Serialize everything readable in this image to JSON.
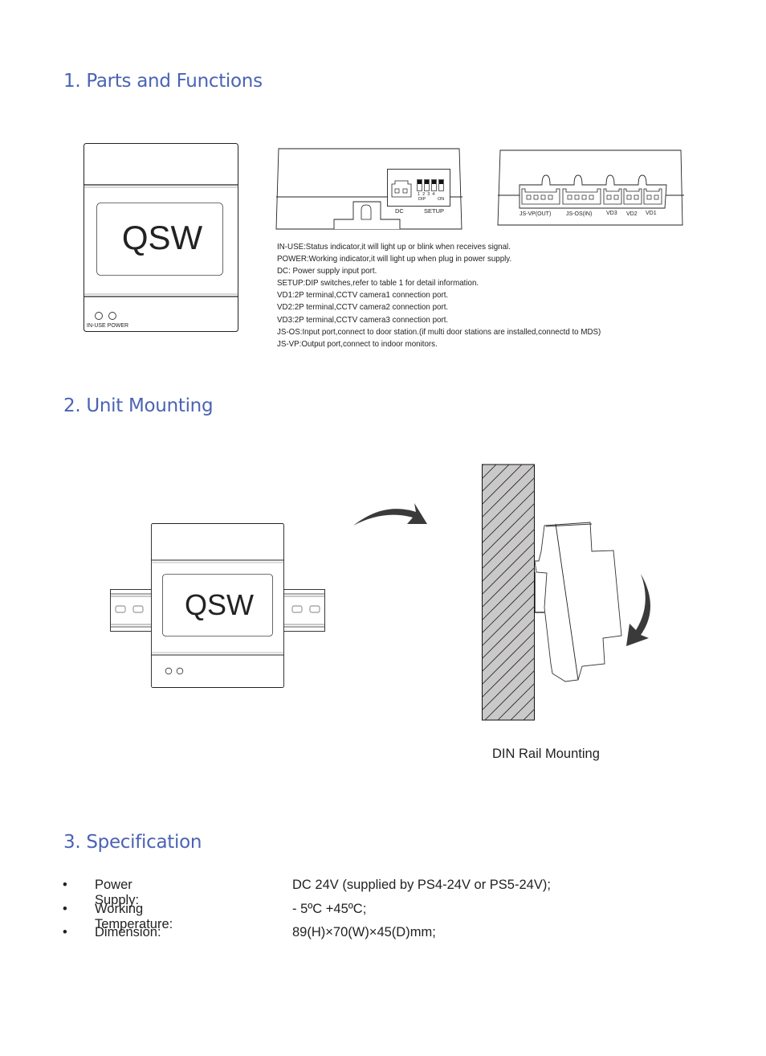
{
  "sections": {
    "parts": {
      "heading": "1. Parts and Functions",
      "front_view": {
        "device_label": "QSW",
        "indicator_labels": "IN-USE POWER"
      },
      "top_view": {
        "dc_label": "DC",
        "setup_label": "SETUP",
        "dip_numbers": "1  2  3  4",
        "dip_left": "DIP",
        "dip_right": "ON"
      },
      "bottom_view": {
        "ports": [
          {
            "label": "JS-VP(OUT)"
          },
          {
            "label": "JS-OS(IN)"
          },
          {
            "label": "VD3"
          },
          {
            "label": "VD2"
          },
          {
            "label": "VD1"
          }
        ]
      },
      "descriptions": [
        "IN-USE:Status indicator,it will light up or blink when receives signal.",
        "POWER:Working indicator,it will light up when plug in power supply.",
        "DC: Power supply input port.",
        "SETUP:DIP switches,refer to table 1 for detail information.",
        "VD1:2P terminal,CCTV camera1 connection port.",
        "VD2:2P terminal,CCTV camera2 connection port.",
        "VD3:2P terminal,CCTV camera3 connection port.",
        "JS-OS:Input port,connect to door station.(if multi door stations are installed,connectd to MDS)",
        "JS-VP:Output port,connect to indoor monitors."
      ]
    },
    "mounting": {
      "heading": "2.  Unit Mounting",
      "device_label": "QSW",
      "caption": "DIN Rail Mounting"
    },
    "specification": {
      "heading": "3. Specification",
      "bullet": "•",
      "items": [
        {
          "label": "Power Supply:",
          "value": "DC 24V (supplied by PS4-24V or PS5-24V);"
        },
        {
          "label": "Working Temperature:",
          "value": "- 5ºC +45ºC;"
        },
        {
          "label": "Dimension:",
          "value": "89(H)×70(W)×45(D)mm;"
        }
      ]
    }
  },
  "colors": {
    "heading": "#4a63b5",
    "wall_fill": "#c8c9c8",
    "arrow": "#3a3a3a"
  }
}
